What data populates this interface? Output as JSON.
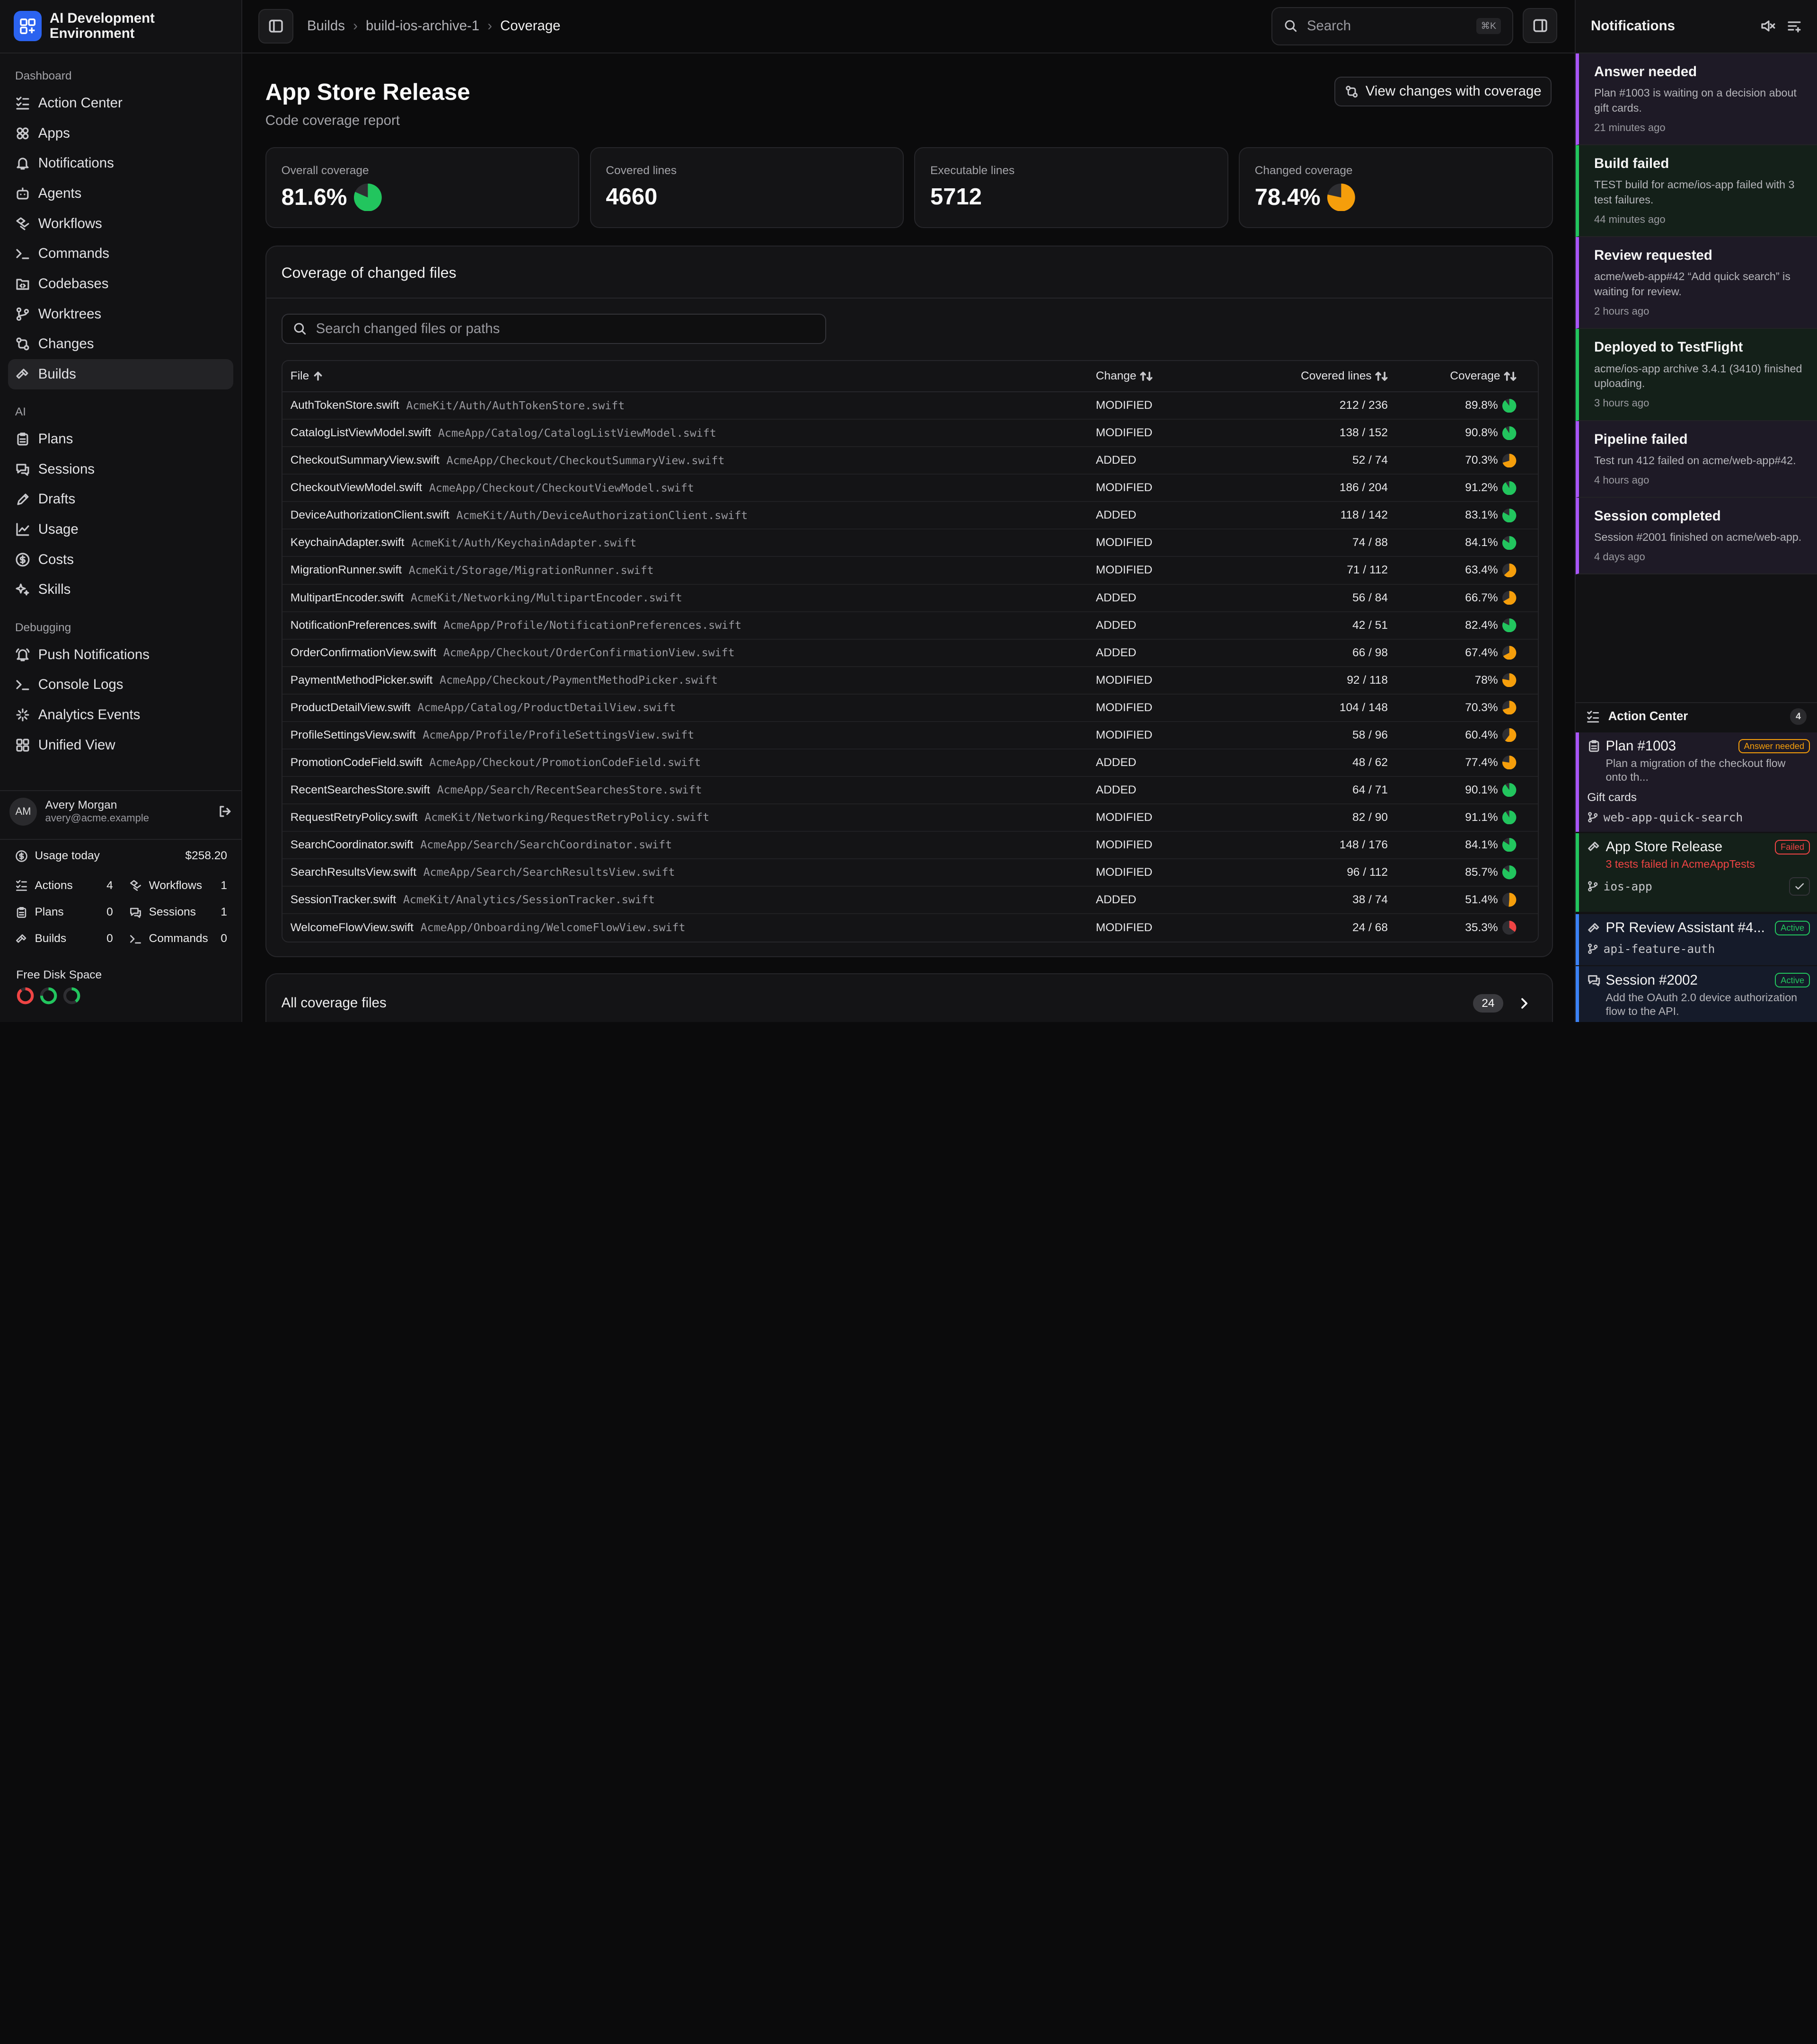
{
  "app": {
    "title": "AI Development Environment"
  },
  "sidebar": {
    "sections": [
      {
        "title": "Dashboard",
        "items": [
          {
            "label": "Action Center",
            "icon": "list-checks-icon"
          },
          {
            "label": "Apps",
            "icon": "apps-icon"
          },
          {
            "label": "Notifications",
            "icon": "bell-icon"
          },
          {
            "label": "Agents",
            "icon": "bot-icon"
          },
          {
            "label": "Workflows",
            "icon": "workflow-icon"
          },
          {
            "label": "Commands",
            "icon": "terminal-icon"
          },
          {
            "label": "Codebases",
            "icon": "folder-code-icon"
          },
          {
            "label": "Worktrees",
            "icon": "git-branch-icon"
          },
          {
            "label": "Changes",
            "icon": "git-compare-icon"
          },
          {
            "label": "Builds",
            "icon": "hammer-icon",
            "active": true
          }
        ]
      },
      {
        "title": "AI",
        "items": [
          {
            "label": "Plans",
            "icon": "clipboard-icon"
          },
          {
            "label": "Sessions",
            "icon": "chat-icon"
          },
          {
            "label": "Drafts",
            "icon": "pencil-icon"
          },
          {
            "label": "Usage",
            "icon": "chart-icon"
          },
          {
            "label": "Costs",
            "icon": "dollar-icon"
          },
          {
            "label": "Skills",
            "icon": "sparkles-icon"
          }
        ]
      },
      {
        "title": "Debugging",
        "items": [
          {
            "label": "Push Notifications",
            "icon": "bell-ring-icon"
          },
          {
            "label": "Console Logs",
            "icon": "terminal-icon"
          },
          {
            "label": "Analytics Events",
            "icon": "activity-icon"
          },
          {
            "label": "Unified View",
            "icon": "layout-icon"
          }
        ]
      }
    ],
    "user": {
      "initials": "AM",
      "name": "Avery Morgan",
      "email": "avery@acme.example"
    },
    "usage": {
      "label": "Usage today",
      "amount": "$258.20",
      "stats": [
        {
          "label": "Actions",
          "value": "4"
        },
        {
          "label": "Workflows",
          "value": "1"
        },
        {
          "label": "Plans",
          "value": "0"
        },
        {
          "label": "Sessions",
          "value": "1"
        },
        {
          "label": "Builds",
          "value": "0"
        },
        {
          "label": "Commands",
          "value": "0"
        }
      ]
    },
    "disk": {
      "label": "Free Disk Space",
      "levels": [
        0.9,
        0.75,
        0.4
      ],
      "colors": [
        "#ef4444",
        "#22c55e",
        "#22c55e"
      ]
    }
  },
  "topbar": {
    "breadcrumbs": [
      "Builds",
      "build-ios-archive-1",
      "Coverage"
    ],
    "search_placeholder": "Search",
    "search_shortcut": "⌘K"
  },
  "page": {
    "title": "App Store Release",
    "subtitle": "Code coverage report",
    "view_changes_label": "View changes with coverage",
    "stats": [
      {
        "label": "Overall coverage",
        "value": "81.6%",
        "pie": 0.816,
        "color": "#22c55e"
      },
      {
        "label": "Covered lines",
        "value": "4660"
      },
      {
        "label": "Executable lines",
        "value": "5712"
      },
      {
        "label": "Changed coverage",
        "value": "78.4%",
        "pie": 0.784,
        "color": "#f59e0b"
      }
    ],
    "changed": {
      "title": "Coverage of changed files",
      "search_placeholder": "Search changed files or paths",
      "columns": [
        "File",
        "Change",
        "Covered lines",
        "Coverage"
      ],
      "rows": [
        {
          "file": "AuthTokenStore.swift",
          "path": "AcmeKit/Auth/AuthTokenStore.swift",
          "change": "MODIFIED",
          "lines": "212 / 236",
          "pct": "89.8%",
          "value": 0.898
        },
        {
          "file": "CatalogListViewModel.swift",
          "path": "AcmeApp/Catalog/CatalogListViewModel.swift",
          "change": "MODIFIED",
          "lines": "138 / 152",
          "pct": "90.8%",
          "value": 0.908
        },
        {
          "file": "CheckoutSummaryView.swift",
          "path": "AcmeApp/Checkout/CheckoutSummaryView.swift",
          "change": "ADDED",
          "lines": "52 / 74",
          "pct": "70.3%",
          "value": 0.703
        },
        {
          "file": "CheckoutViewModel.swift",
          "path": "AcmeApp/Checkout/CheckoutViewModel.swift",
          "change": "MODIFIED",
          "lines": "186 / 204",
          "pct": "91.2%",
          "value": 0.912
        },
        {
          "file": "DeviceAuthorizationClient.swift",
          "path": "AcmeKit/Auth/DeviceAuthorizationClient.swift",
          "change": "ADDED",
          "lines": "118 / 142",
          "pct": "83.1%",
          "value": 0.831
        },
        {
          "file": "KeychainAdapter.swift",
          "path": "AcmeKit/Auth/KeychainAdapter.swift",
          "change": "MODIFIED",
          "lines": "74 / 88",
          "pct": "84.1%",
          "value": 0.841
        },
        {
          "file": "MigrationRunner.swift",
          "path": "AcmeKit/Storage/MigrationRunner.swift",
          "change": "MODIFIED",
          "lines": "71 / 112",
          "pct": "63.4%",
          "value": 0.634
        },
        {
          "file": "MultipartEncoder.swift",
          "path": "AcmeKit/Networking/MultipartEncoder.swift",
          "change": "ADDED",
          "lines": "56 / 84",
          "pct": "66.7%",
          "value": 0.667
        },
        {
          "file": "NotificationPreferences.swift",
          "path": "AcmeApp/Profile/NotificationPreferences.swift",
          "change": "ADDED",
          "lines": "42 / 51",
          "pct": "82.4%",
          "value": 0.824
        },
        {
          "file": "OrderConfirmationView.swift",
          "path": "AcmeApp/Checkout/OrderConfirmationView.swift",
          "change": "ADDED",
          "lines": "66 / 98",
          "pct": "67.4%",
          "value": 0.674
        },
        {
          "file": "PaymentMethodPicker.swift",
          "path": "AcmeApp/Checkout/PaymentMethodPicker.swift",
          "change": "MODIFIED",
          "lines": "92 / 118",
          "pct": "78%",
          "value": 0.78
        },
        {
          "file": "ProductDetailView.swift",
          "path": "AcmeApp/Catalog/ProductDetailView.swift",
          "change": "MODIFIED",
          "lines": "104 / 148",
          "pct": "70.3%",
          "value": 0.703
        },
        {
          "file": "ProfileSettingsView.swift",
          "path": "AcmeApp/Profile/ProfileSettingsView.swift",
          "change": "MODIFIED",
          "lines": "58 / 96",
          "pct": "60.4%",
          "value": 0.604
        },
        {
          "file": "PromotionCodeField.swift",
          "path": "AcmeApp/Checkout/PromotionCodeField.swift",
          "change": "ADDED",
          "lines": "48 / 62",
          "pct": "77.4%",
          "value": 0.774
        },
        {
          "file": "RecentSearchesStore.swift",
          "path": "AcmeApp/Search/RecentSearchesStore.swift",
          "change": "ADDED",
          "lines": "64 / 71",
          "pct": "90.1%",
          "value": 0.901
        },
        {
          "file": "RequestRetryPolicy.swift",
          "path": "AcmeKit/Networking/RequestRetryPolicy.swift",
          "change": "MODIFIED",
          "lines": "82 / 90",
          "pct": "91.1%",
          "value": 0.911
        },
        {
          "file": "SearchCoordinator.swift",
          "path": "AcmeApp/Search/SearchCoordinator.swift",
          "change": "MODIFIED",
          "lines": "148 / 176",
          "pct": "84.1%",
          "value": 0.841
        },
        {
          "file": "SearchResultsView.swift",
          "path": "AcmeApp/Search/SearchResultsView.swift",
          "change": "MODIFIED",
          "lines": "96 / 112",
          "pct": "85.7%",
          "value": 0.857
        },
        {
          "file": "SessionTracker.swift",
          "path": "AcmeKit/Analytics/SessionTracker.swift",
          "change": "ADDED",
          "lines": "38 / 74",
          "pct": "51.4%",
          "value": 0.514
        },
        {
          "file": "WelcomeFlowView.swift",
          "path": "AcmeApp/Onboarding/WelcomeFlowView.swift",
          "change": "MODIFIED",
          "lines": "24 / 68",
          "pct": "35.3%",
          "value": 0.353
        }
      ]
    },
    "all_files": {
      "label": "All coverage files",
      "count": "24"
    }
  },
  "notifications": {
    "title": "Notifications",
    "items": [
      {
        "title": "Answer needed",
        "body": "Plan #1003 is waiting on a decision about gift cards.",
        "time": "21 minutes ago",
        "color": "#a855f7",
        "bg": "#1e1a26"
      },
      {
        "title": "Build failed",
        "body": "TEST build for acme/ios-app failed with 3 test failures.",
        "time": "44 minutes ago",
        "color": "#22c55e",
        "bg": "#142019"
      },
      {
        "title": "Review requested",
        "body": "acme/web-app#42 “Add quick search” is waiting for review.",
        "time": "2 hours ago",
        "color": "#a855f7",
        "bg": "#1e1a26"
      },
      {
        "title": "Deployed to TestFlight",
        "body": "acme/ios-app archive 3.4.1 (3410) finished uploading.",
        "time": "3 hours ago",
        "color": "#22c55e",
        "bg": "#142019"
      },
      {
        "title": "Pipeline failed",
        "body": "Test run 412 failed on acme/web-app#42.",
        "time": "4 hours ago",
        "color": "#a855f7",
        "bg": "#1e1a26"
      },
      {
        "title": "Session completed",
        "body": "Session #2001 finished on acme/web-app.",
        "time": "4 days ago",
        "color": "#a855f7",
        "bg": "#1e1a26"
      }
    ]
  },
  "action_center": {
    "title": "Action Center",
    "count": "4",
    "items": [
      {
        "title": "Plan #1003",
        "badge": "Answer needed",
        "sub": "Plan a migration of the checkout flow onto th...",
        "extra": "Gift cards",
        "branch": "web-app-quick-search",
        "color": "#a855f7",
        "badge_color": "#f59e0b"
      },
      {
        "title": "App Store Release",
        "badge": "Failed",
        "sub": "3 tests failed in AcmeAppTests",
        "branch": "ios-app",
        "color": "#22c55e",
        "badge_color": "#ef4444"
      },
      {
        "title": "PR Review Assistant #4...",
        "badge": "Active",
        "branch": "api-feature-auth",
        "color": "#3b82f6",
        "badge_color": "#22c55e"
      },
      {
        "title": "Session #2002",
        "badge": "Active",
        "sub": "Add the OAuth 2.0 device authorization flow to the API.",
        "color": "#3b82f6",
        "badge_color": "#22c55e"
      }
    ]
  }
}
